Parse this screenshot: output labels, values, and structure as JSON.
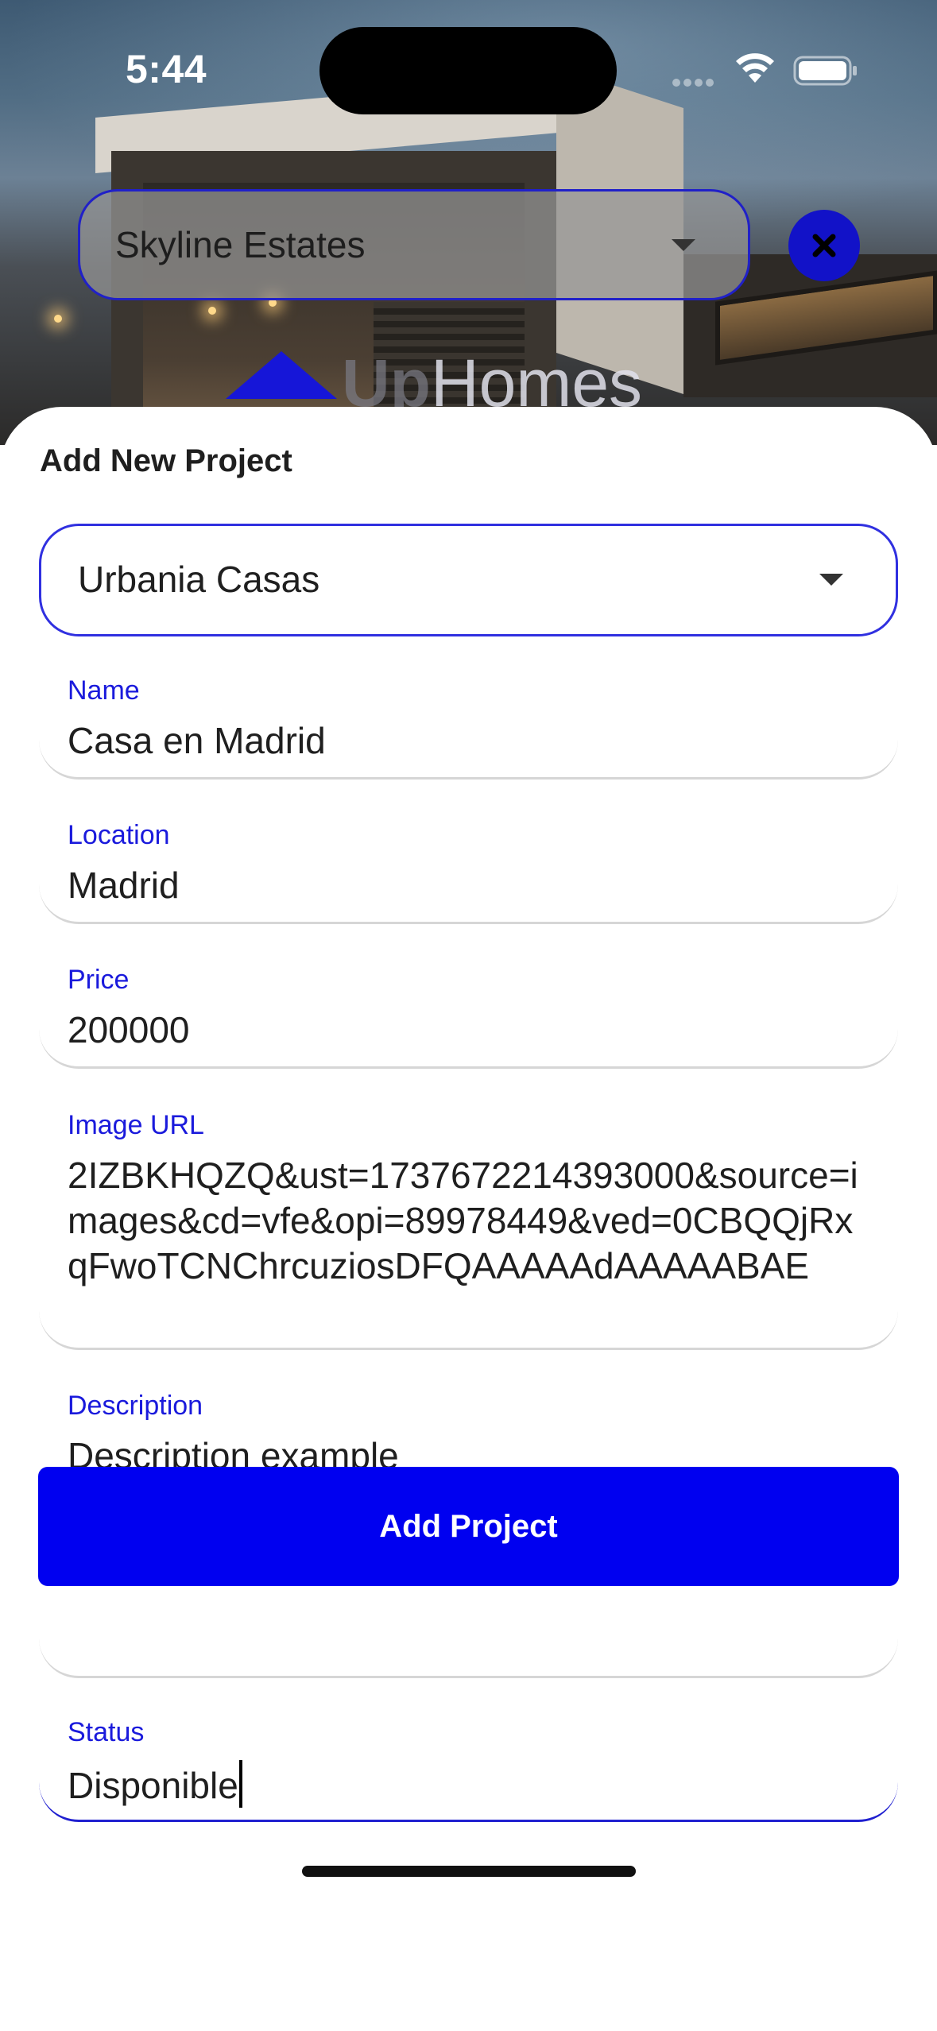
{
  "status_bar": {
    "time": "5:44"
  },
  "header": {
    "selected_company": "Skyline Estates",
    "logo": {
      "part1": "Up",
      "part2": "Homes"
    },
    "close_icon": "close-icon"
  },
  "sheet": {
    "title": "Add New Project",
    "project_select": "Urbania Casas",
    "fields": {
      "name": {
        "label": "Name",
        "value": "Casa en Madrid"
      },
      "location": {
        "label": "Location",
        "value": "Madrid"
      },
      "price": {
        "label": "Price",
        "value": "200000"
      },
      "image_url": {
        "label": "Image URL",
        "value": "2IZBKHQZQ&ust=1737672214393000&source=images&cd=vfe&opi=89978449&ved=0CBQQjRxqFwoTCNChrcuziosDFQAAAAAdAAAAABAE"
      },
      "description": {
        "label": "Description",
        "value": "Description example"
      },
      "status": {
        "label": "Status",
        "value": "Disponible"
      }
    },
    "submit_label": "Add Project"
  },
  "colors": {
    "accent": "#0000f0",
    "label": "#1a1adc",
    "close_button": "#1212c8"
  }
}
